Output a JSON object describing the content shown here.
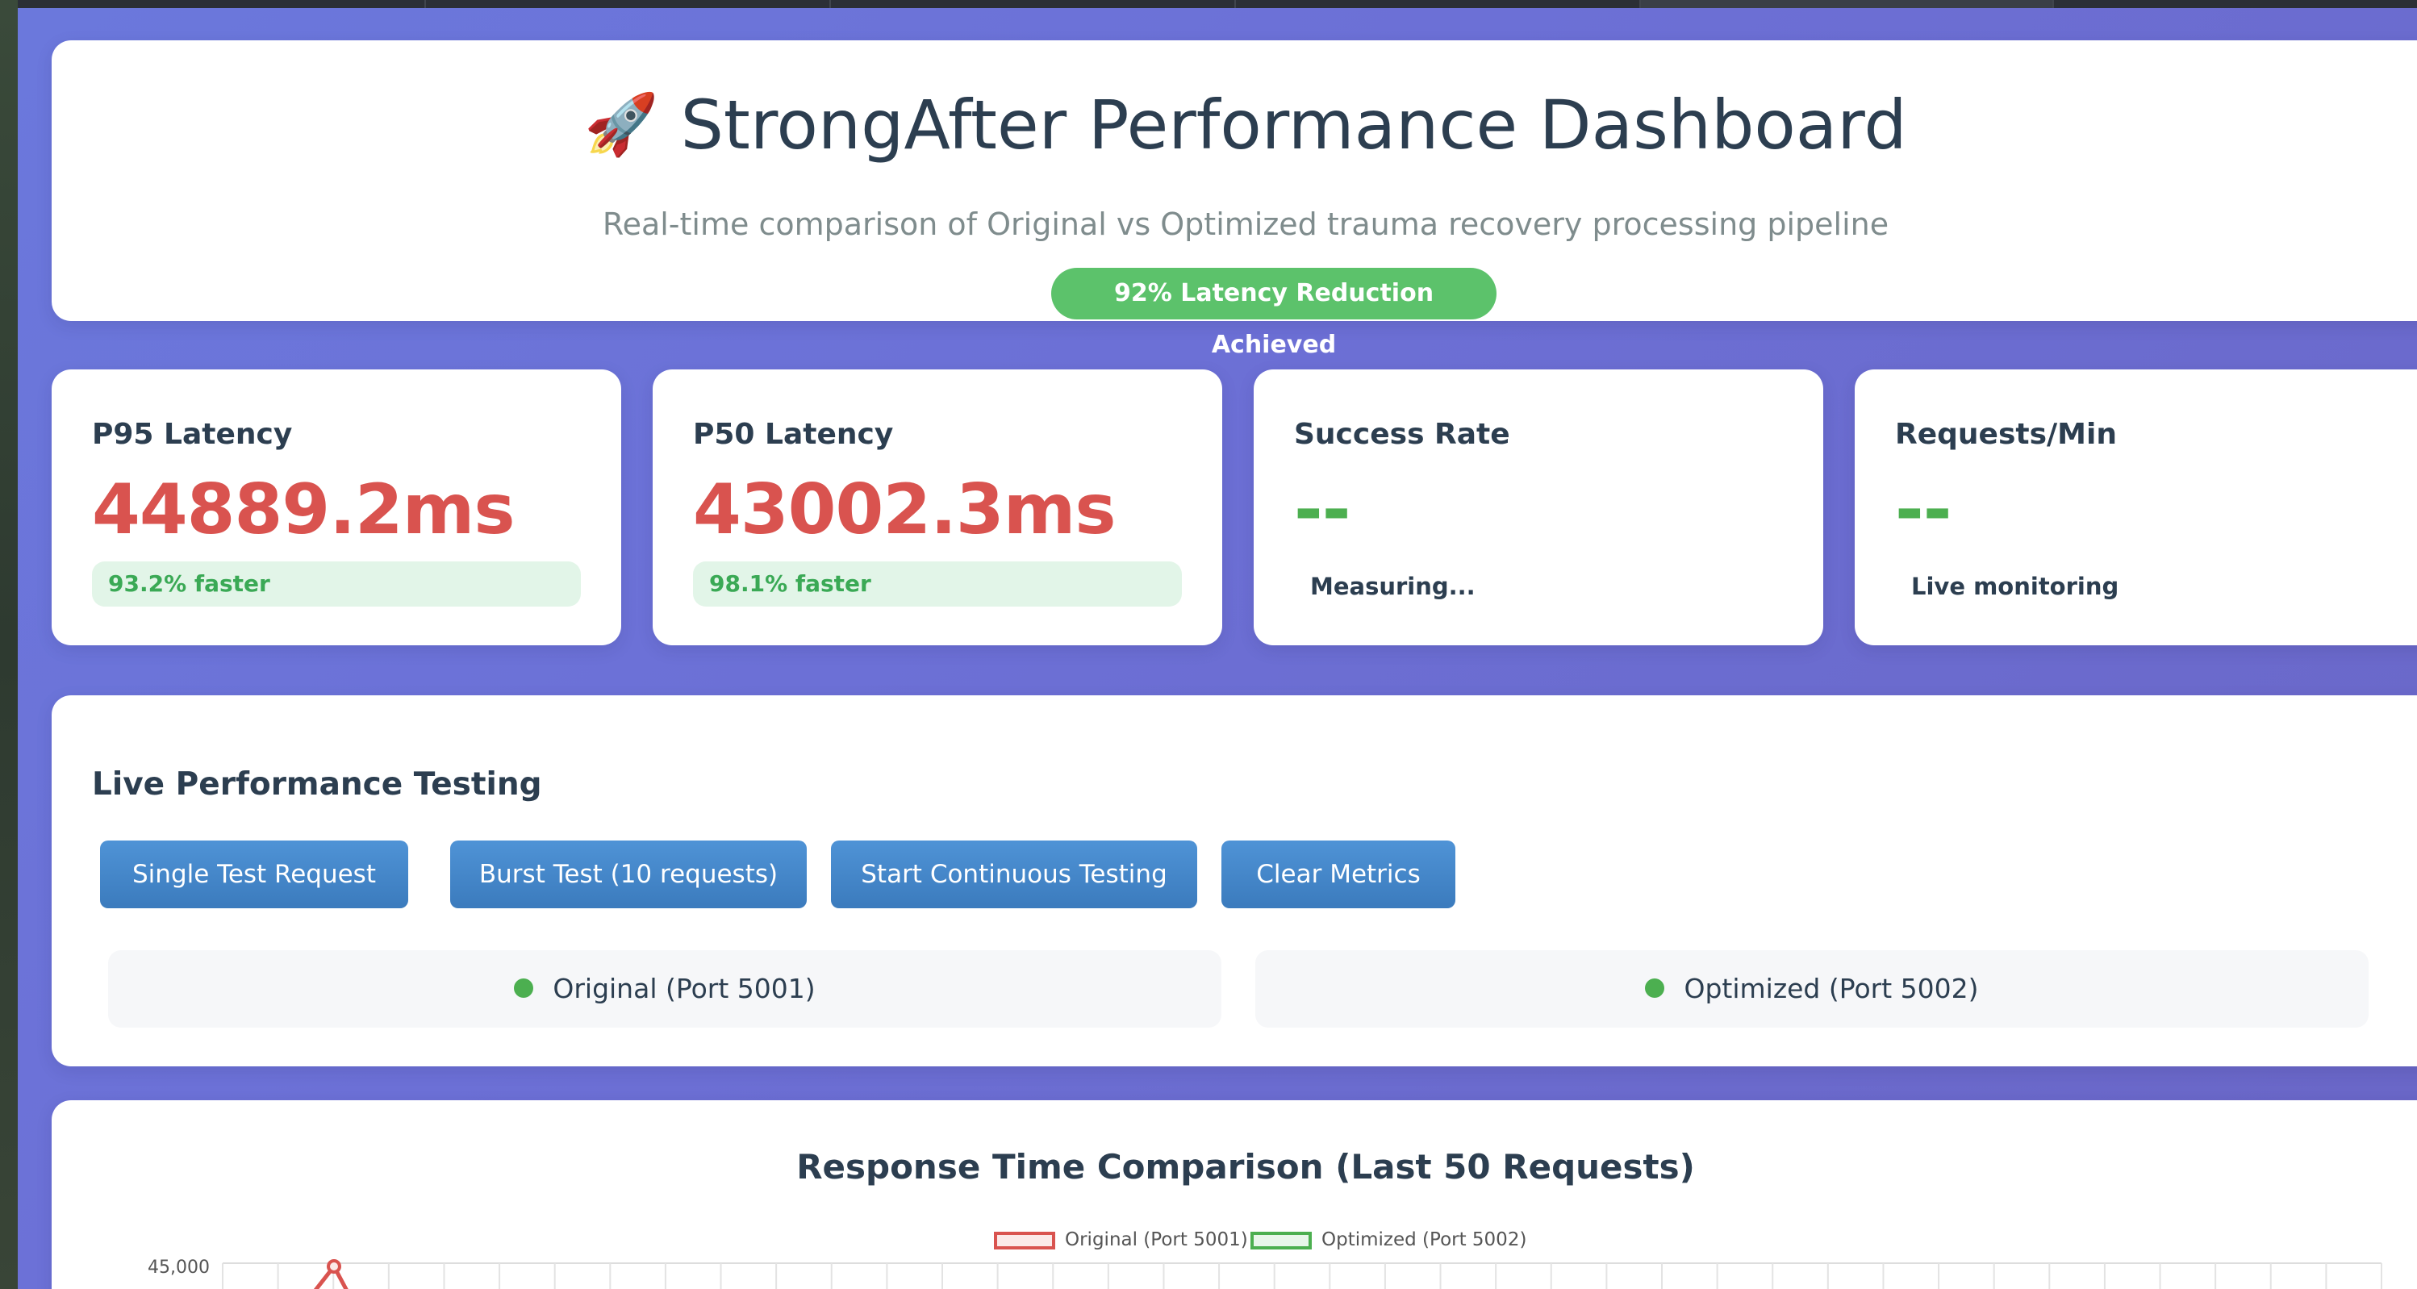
{
  "header": {
    "rocket": "🚀",
    "title": "StrongAfter Performance Dashboard",
    "subtitle": "Real-time comparison of Original vs Optimized trauma recovery processing pipeline",
    "badge": "92% Latency Reduction Achieved"
  },
  "metrics": [
    {
      "label": "P95 Latency",
      "value": "44889.2ms",
      "delta": "93.2% faster"
    },
    {
      "label": "P50 Latency",
      "value": "43002.3ms",
      "delta": "98.1% faster"
    },
    {
      "label": "Success Rate",
      "value": "--",
      "note": "Measuring..."
    },
    {
      "label": "Requests/Min",
      "value": "--",
      "note": "Live monitoring"
    }
  ],
  "live": {
    "title": "Live Performance Testing",
    "buttons": [
      "Single Test Request",
      "Burst Test (10 requests)",
      "Start Continuous Testing",
      "Clear Metrics"
    ],
    "status": [
      {
        "label": "Original (Port 5001)",
        "state_color": "#4caf50"
      },
      {
        "label": "Optimized (Port 5002)",
        "state_color": "#4caf50"
      }
    ]
  },
  "colors": {
    "original": "#d9534f",
    "optimized": "#4caf50",
    "button": "#3f83c9",
    "badge": "#5cc26b"
  },
  "chart_data": {
    "type": "line",
    "title": "Response Time Comparison (Last 50 Requests)",
    "series": [
      {
        "name": "Original (Port 5001)",
        "values": [
          44889
        ]
      },
      {
        "name": "Optimized (Port 5002)",
        "values": []
      }
    ],
    "y_ticks": [
      "45,000"
    ],
    "grid": true,
    "legend": "top"
  }
}
